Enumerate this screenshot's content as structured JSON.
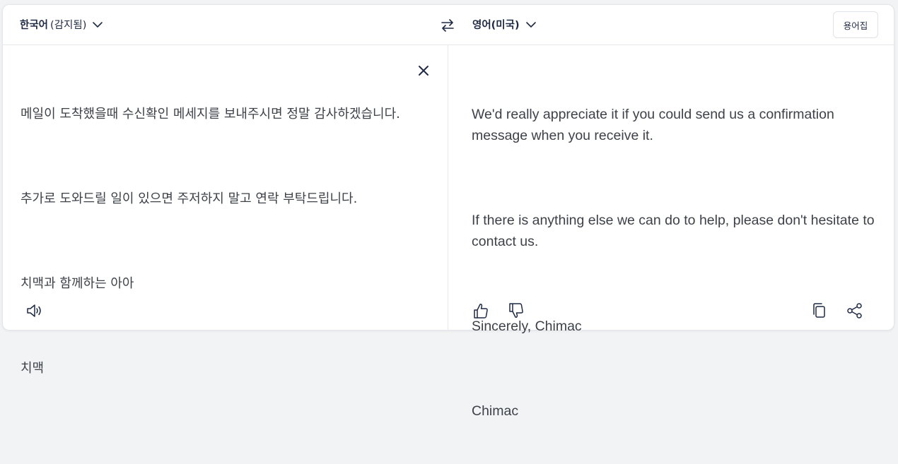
{
  "source": {
    "language": "한국어",
    "detected_label": "(감지됨)",
    "paragraphs": [
      "메일이 도착했을때 수신확인 메세지를 보내주시면 정말 감사하겠습니다.",
      "추가로 도와드릴 일이 있으면 주저하지 말고 연락 부탁드립니다.",
      "치맥과 함께하는 아아",
      "치맥"
    ]
  },
  "target": {
    "language": "영어(미국)",
    "paragraphs": [
      "We'd really appreciate it if you could send us a confirmation message when you receive it.",
      "If there is anything else we can do to help, please don't hesitate to contact us.",
      "Sincerely, Chimac",
      "Chimac"
    ]
  },
  "toolbar": {
    "glossary_label": "용어집"
  },
  "icons": {
    "swap": "swap-arrows-icon",
    "clear": "close-icon",
    "speaker": "speaker-icon",
    "thumbs_up": "thumbs-up-icon",
    "thumbs_down": "thumbs-down-icon",
    "copy": "copy-icon",
    "share": "share-icon"
  },
  "colors": {
    "icon": "#1f2a44",
    "text": "#3d4148",
    "border": "#e6e8eb"
  }
}
